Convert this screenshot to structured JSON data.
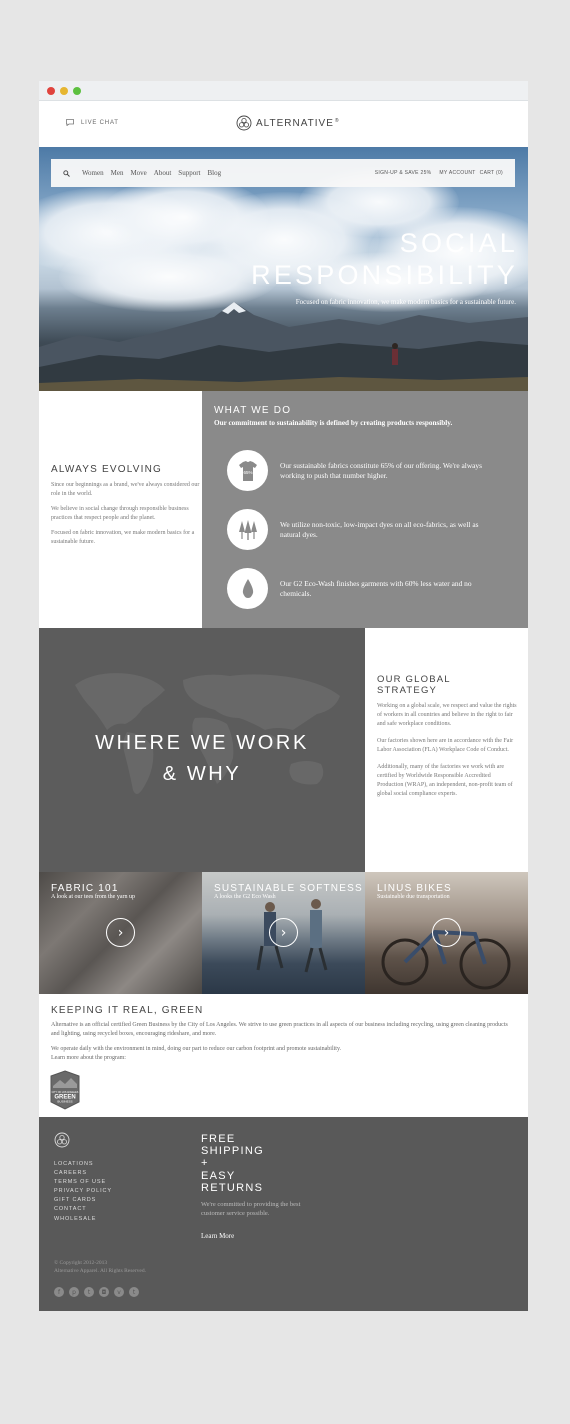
{
  "header": {
    "live_chat": "LIVE CHAT",
    "brand": "ALTERNATIVE",
    "brand_mark": "®"
  },
  "nav": {
    "items": [
      "Women",
      "Men",
      "Move",
      "About",
      "Support",
      "Blog"
    ],
    "signup": "SIGN-UP & SAVE 25%",
    "account": "MY ACCOUNT",
    "cart": "CART (0)"
  },
  "hero": {
    "line1": "SOCIAL",
    "line2": "RESPONSIBILITY",
    "subtitle": "Focused on fabric innovation, we make modern basics for a sustainable future."
  },
  "evolving": {
    "title": "ALWAYS EVOLVING",
    "p1": "Since our beginnings as a brand, we've always considered our role in the world.",
    "p2": "We believe in social change through responsible business practices that respect people and the planet.",
    "p3": "Focused on fabric innovation, we make modern basics for a sustainable future."
  },
  "what_we_do": {
    "title": "WHAT WE DO",
    "lead": "Our commitment to sustainability is defined by creating products responsibly.",
    "features": [
      {
        "icon": "shirt-icon",
        "badge": "65%",
        "text": "Our sustainable fabrics constitute 65% of our offering. We're always working to push that number higher."
      },
      {
        "icon": "trees-icon",
        "text": "We utilize non-toxic, low-impact dyes on all eco-fabrics, as well as natural dyes."
      },
      {
        "icon": "water-drop-icon",
        "text": "Our G2 Eco-Wash finishes garments with 60% less water and no chemicals."
      }
    ]
  },
  "where": {
    "line1": "WHERE WE WORK",
    "line2": "& WHY"
  },
  "strategy": {
    "title1": "OUR GLOBAL",
    "title2": "STRATEGY",
    "p1": "Working on a global scale, we respect and value the rights of workers in all countries and believe in the right to fair and safe workplace conditions.",
    "p2": "Our factories shown here are in accordance with the Fair Labor Association (FLA) Workplace Code of Conduct.",
    "p3": "Additionally, many of the factories we work with are certified by Worldwide Responsible Accredited Production (WRAP), an independent, non-profit team of global social compliance experts."
  },
  "cards": [
    {
      "title": "FABRIC 101",
      "subtitle": "A look at our tees from the yarn up"
    },
    {
      "title": "SUSTAINABLE SOFTNESS",
      "subtitle": "A looks the G2 Eco Wash"
    },
    {
      "title": "LINUS BIKES",
      "subtitle": "Sustainable due transportation"
    }
  ],
  "green": {
    "title": "KEEPING IT REAL, GREEN",
    "p1": "Alternative is an official certified Green Business by the City of Los Angeles. We strive to use green practices in all aspects of our business including recycling, using green cleaning products and lighting, using recycled boxes, encouraging rideshare, and more.",
    "p2": "We operate daily with the environment in mind, doing our part to reduce our carbon footprint and promote sustainability.",
    "p3": "Learn more about the program:",
    "badge_top": "CITY OF LOS ANGELES",
    "badge_main": "GREEN",
    "badge_bottom": "BUSINESS"
  },
  "footer": {
    "links": [
      "LOCATIONS",
      "CAREERS",
      "TERMS OF USE",
      "PRIVACY POLICY",
      "GIFT CARDS",
      "CONTACT",
      "WHOLESALE"
    ],
    "promo": [
      "FREE",
      "SHIPPING",
      "+",
      "EASY",
      "RETURNS"
    ],
    "promo_sub": "We're committed to providing the best customer service possible.",
    "learn_more": "Learn More",
    "copyright1": "© Copyright 2012-2013",
    "copyright2": "Alternative Apparel. All Rights Reserved.",
    "social": [
      {
        "icon": "facebook-icon",
        "glyph": "f"
      },
      {
        "icon": "pinterest-icon",
        "glyph": "p"
      },
      {
        "icon": "twitter-icon",
        "glyph": "t"
      },
      {
        "icon": "instagram-icon",
        "glyph": "◘"
      },
      {
        "icon": "vimeo-icon",
        "glyph": "v"
      },
      {
        "icon": "tumblr-icon",
        "glyph": "t"
      }
    ]
  }
}
